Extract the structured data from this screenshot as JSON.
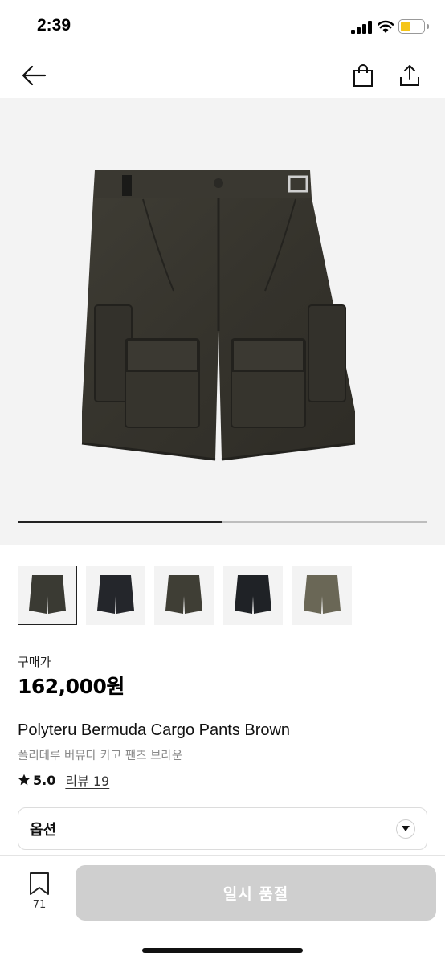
{
  "status_bar": {
    "time": "2:39",
    "battery_level": 0.45
  },
  "nav": {
    "icons": [
      "back-arrow-icon",
      "shopping-bag-icon",
      "share-icon"
    ]
  },
  "gallery": {
    "progress": 0.5,
    "thumbnail_colors": [
      "#3a3a33",
      "#24262b",
      "#3f3e35",
      "#1f2226",
      "#6a6756"
    ],
    "active_thumbnail": 0
  },
  "product": {
    "price_label": "구매가",
    "price": "162,000원",
    "name_en": "Polyteru Bermuda Cargo Pants Brown",
    "name_ko": "폴리테루 버뮤다 카고 팬츠 브라운",
    "rating": "5.0",
    "review_link": "리뷰 19"
  },
  "options": {
    "label": "옵션"
  },
  "bottom_bar": {
    "wish_count": "71",
    "buy_label": "일시 품절"
  },
  "colors": {
    "disabled_button": "#cfcfcf",
    "hero_bg": "#f3f3f3"
  }
}
